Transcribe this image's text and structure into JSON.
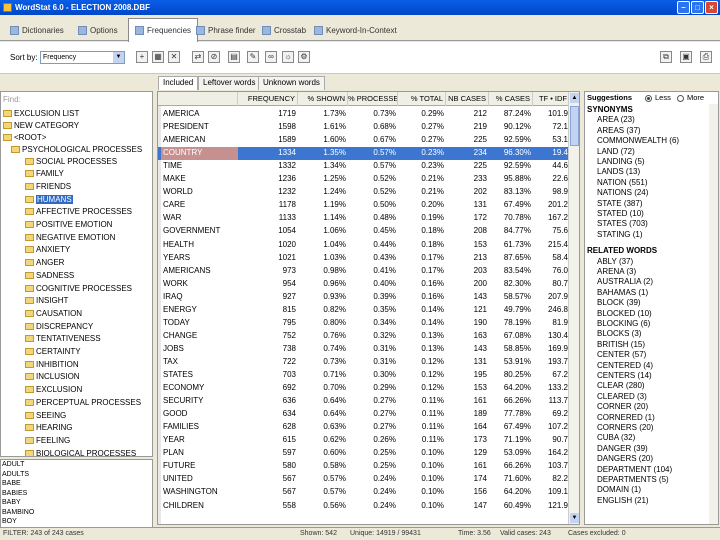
{
  "window": {
    "title": "WordStat 6.0 - ELECTION 2008.DBF"
  },
  "tabs": [
    "Dictionaries",
    "Options",
    "Frequencies",
    "Phrase finder",
    "Crosstab",
    "Keyword-In-Context"
  ],
  "toolbar": {
    "sort_label": "Sort by:",
    "sort_value": "Frequency"
  },
  "subtabs": [
    "Included",
    "Leftover words",
    "Unknown words"
  ],
  "tree": {
    "search_label": "Find:",
    "root_items": [
      "EXCLUSION LIST",
      "NEW CATEGORY",
      "<ROOT>"
    ],
    "psych": "PSYCHOLOGICAL PROCESSES",
    "children": [
      "SOCIAL PROCESSES",
      "FAMILY",
      "FRIENDS",
      "HUMANS",
      "AFFECTIVE PROCESSES",
      "POSITIVE EMOTION",
      "NEGATIVE EMOTION",
      "ANXIETY",
      "ANGER",
      "SADNESS",
      "COGNITIVE PROCESSES",
      "INSIGHT",
      "CAUSATION",
      "DISCREPANCY",
      "TENTATIVENESS",
      "CERTAINTY",
      "INHIBITION",
      "INCLUSION",
      "EXCLUSION",
      "PERCEPTUAL PROCESSES",
      "SEEING",
      "HEARING",
      "FEELING",
      "BIOLOGICAL PROCESSES"
    ]
  },
  "wordlist": [
    "ADULT",
    "ADULTS",
    "BABE",
    "BABIES",
    "BABY",
    "BAMBINO",
    "BOY"
  ],
  "grid": {
    "columns": [
      "",
      "FREQUENCY",
      "% SHOWN",
      "% PROCESSED",
      "% TOTAL",
      "NB CASES",
      "% CASES",
      "TF • IDF"
    ],
    "rows": [
      [
        "AMERICA",
        "1719",
        "1.73%",
        "0.73%",
        "0.29%",
        "212",
        "87.24%",
        "101.9"
      ],
      [
        "PRESIDENT",
        "1598",
        "1.61%",
        "0.68%",
        "0.27%",
        "219",
        "90.12%",
        "72.1"
      ],
      [
        "AMERICAN",
        "1589",
        "1.60%",
        "0.67%",
        "0.27%",
        "225",
        "92.59%",
        "53.1"
      ],
      [
        "COUNTRY",
        "1334",
        "1.35%",
        "0.57%",
        "0.23%",
        "234",
        "96.30%",
        "19.4"
      ],
      [
        "TIME",
        "1332",
        "1.34%",
        "0.57%",
        "0.23%",
        "225",
        "92.59%",
        "44.6"
      ],
      [
        "MAKE",
        "1236",
        "1.25%",
        "0.52%",
        "0.21%",
        "233",
        "95.88%",
        "22.6"
      ],
      [
        "WORLD",
        "1232",
        "1.24%",
        "0.52%",
        "0.21%",
        "202",
        "83.13%",
        "98.9"
      ],
      [
        "CARE",
        "1178",
        "1.19%",
        "0.50%",
        "0.20%",
        "131",
        "67.49%",
        "201.2"
      ],
      [
        "WAR",
        "1133",
        "1.14%",
        "0.48%",
        "0.19%",
        "172",
        "70.78%",
        "167.2"
      ],
      [
        "GOVERNMENT",
        "1054",
        "1.06%",
        "0.45%",
        "0.18%",
        "208",
        "84.77%",
        "75.6"
      ],
      [
        "HEALTH",
        "1020",
        "1.04%",
        "0.44%",
        "0.18%",
        "153",
        "61.73%",
        "215.4"
      ],
      [
        "YEARS",
        "1021",
        "1.03%",
        "0.43%",
        "0.17%",
        "213",
        "87.65%",
        "58.4"
      ],
      [
        "AMERICANS",
        "973",
        "0.98%",
        "0.41%",
        "0.17%",
        "203",
        "83.54%",
        "76.0"
      ],
      [
        "WORK",
        "954",
        "0.96%",
        "0.40%",
        "0.16%",
        "200",
        "82.30%",
        "80.7"
      ],
      [
        "IRAQ",
        "927",
        "0.93%",
        "0.39%",
        "0.16%",
        "143",
        "58.57%",
        "207.9"
      ],
      [
        "ENERGY",
        "815",
        "0.82%",
        "0.35%",
        "0.14%",
        "121",
        "49.79%",
        "246.8"
      ],
      [
        "TODAY",
        "795",
        "0.80%",
        "0.34%",
        "0.14%",
        "190",
        "78.19%",
        "81.9"
      ],
      [
        "CHANGE",
        "752",
        "0.76%",
        "0.32%",
        "0.13%",
        "163",
        "67.08%",
        "130.4"
      ],
      [
        "JOBS",
        "738",
        "0.74%",
        "0.31%",
        "0.13%",
        "143",
        "58.85%",
        "169.9"
      ],
      [
        "TAX",
        "722",
        "0.73%",
        "0.31%",
        "0.12%",
        "131",
        "53.91%",
        "193.7"
      ],
      [
        "STATES",
        "703",
        "0.71%",
        "0.30%",
        "0.12%",
        "195",
        "80.25%",
        "67.2"
      ],
      [
        "ECONOMY",
        "692",
        "0.70%",
        "0.29%",
        "0.12%",
        "153",
        "64.20%",
        "133.2"
      ],
      [
        "SECURITY",
        "636",
        "0.64%",
        "0.27%",
        "0.11%",
        "161",
        "66.26%",
        "113.7"
      ],
      [
        "GOOD",
        "634",
        "0.64%",
        "0.27%",
        "0.11%",
        "189",
        "77.78%",
        "69.2"
      ],
      [
        "FAMILIES",
        "628",
        "0.63%",
        "0.27%",
        "0.11%",
        "164",
        "67.49%",
        "107.2"
      ],
      [
        "YEAR",
        "615",
        "0.62%",
        "0.26%",
        "0.11%",
        "173",
        "71.19%",
        "90.7"
      ],
      [
        "PLAN",
        "597",
        "0.60%",
        "0.25%",
        "0.10%",
        "129",
        "53.09%",
        "164.2"
      ],
      [
        "FUTURE",
        "580",
        "0.58%",
        "0.25%",
        "0.10%",
        "161",
        "66.26%",
        "103.7"
      ],
      [
        "UNITED",
        "567",
        "0.57%",
        "0.24%",
        "0.10%",
        "174",
        "71.60%",
        "82.2"
      ],
      [
        "WASHINGTON",
        "567",
        "0.57%",
        "0.24%",
        "0.10%",
        "156",
        "64.20%",
        "109.1"
      ],
      [
        "CHILDREN",
        "558",
        "0.56%",
        "0.24%",
        "0.10%",
        "147",
        "60.49%",
        "121.9"
      ]
    ]
  },
  "suggestions": {
    "label": "Suggestions",
    "opt_less": "Less",
    "opt_more": "More",
    "syn_head": "SYNONYMS",
    "synonyms": [
      "AREA (23)",
      "AREAS (37)",
      "COMMONWEALTH (6)",
      "LAND (72)",
      "LANDING (5)",
      "LANDS (13)",
      "NATION (551)",
      "NATIONS (24)",
      "STATE (387)",
      "STATED (10)",
      "STATES (703)",
      "STATING (1)"
    ],
    "rel_head": "RELATED WORDS",
    "related": [
      "ABLY (37)",
      "ARENA (3)",
      "AUSTRALIA (2)",
      "BAHAMAS (1)",
      "BLOCK (39)",
      "BLOCKED (10)",
      "BLOCKING (6)",
      "BLOCKS (3)",
      "BRITISH (15)",
      "CENTER (57)",
      "CENTERED (4)",
      "CENTERS (14)",
      "CLEAR (280)",
      "CLEARED (3)",
      "CORNER (20)",
      "CORNERED (1)",
      "CORNERS (20)",
      "CUBA (32)",
      "DANGER (39)",
      "DANGERS (20)",
      "DEPARTMENT (104)",
      "DEPARTMENTS (5)",
      "DOMAIN (1)",
      "ENGLISH (21)"
    ]
  },
  "status": {
    "filter": "FILTER: 243 of 243 cases",
    "shown": "Shown: 542",
    "unique": "Unique: 14919 / 99431",
    "time": "Time: 3.56",
    "valid": "Valid cases: 243",
    "excluded": "Cases excluded: 0"
  },
  "colors": {
    "selection": "#3d76d1",
    "highlight_word": "#c79090",
    "titlebar": "#0a5ee8"
  }
}
